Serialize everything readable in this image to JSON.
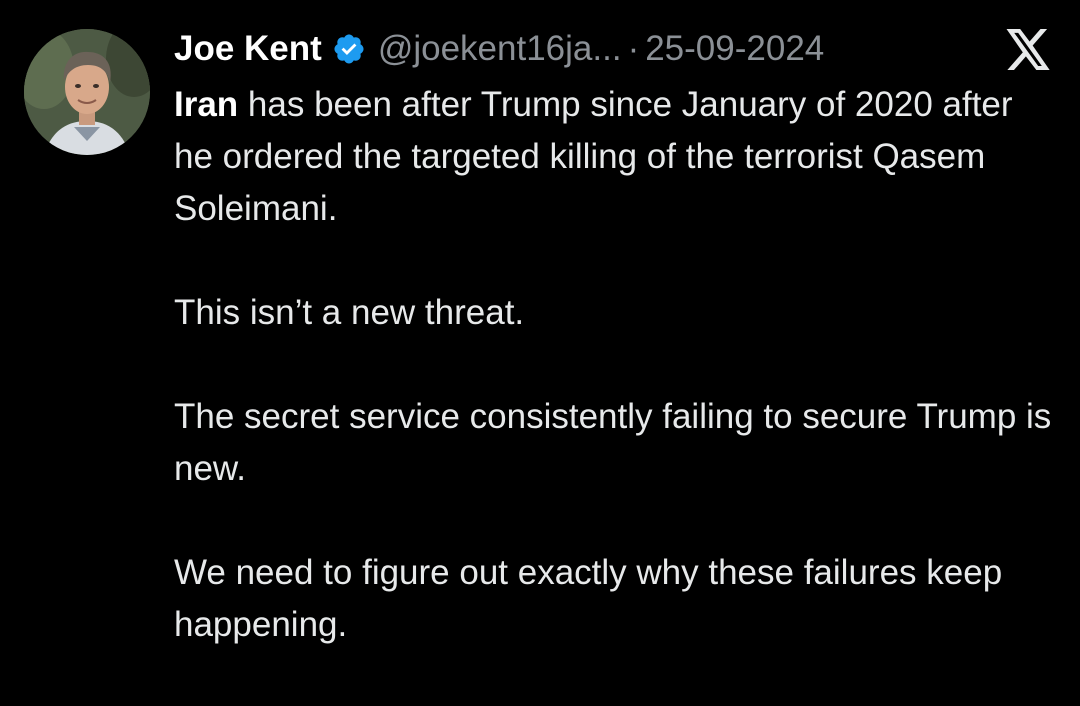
{
  "tweet": {
    "author_name": "Joe Kent",
    "handle": "@joekent16ja...",
    "separator": "·",
    "date": "25-09-2024",
    "lead_word": "Iran",
    "paragraphs": [
      " has been after Trump since January of 2020 after he ordered the targeted killing of the terrorist Qasem Soleimani.",
      "This isn’t a new threat.",
      "The secret service consistently failing to secure Trump is new.",
      "We need to figure out exactly why these failures keep happening."
    ]
  },
  "icons": {
    "verified": "verified-badge-icon",
    "platform": "x-logo-icon",
    "avatar": "profile-photo"
  },
  "colors": {
    "background": "#000000",
    "text": "#e7e9ea",
    "muted": "#8b9096",
    "verified_blue": "#1d9bf0"
  }
}
